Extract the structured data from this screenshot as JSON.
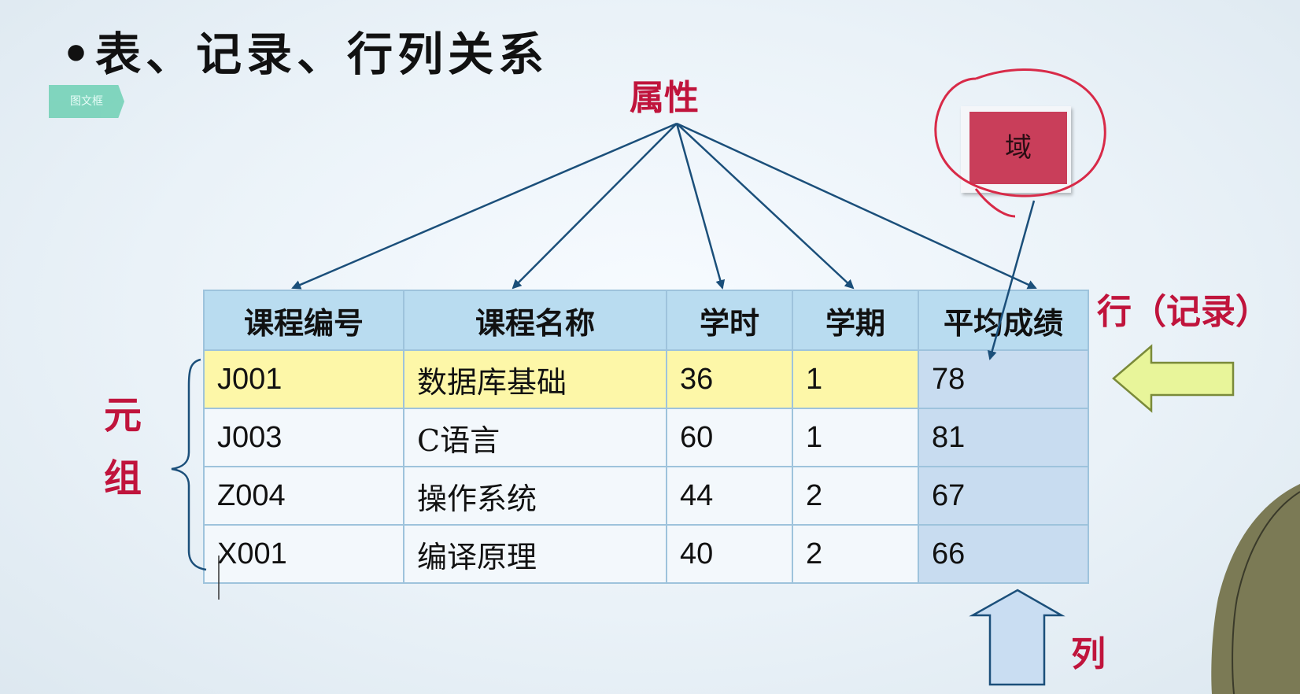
{
  "slide": {
    "title": "•表、记录、行列关系",
    "tag_label": "图文框"
  },
  "labels": {
    "attribute": "属性",
    "row_record": "行（记录）",
    "tuple": "元组",
    "column": "列",
    "domain": "域"
  },
  "table": {
    "headers": [
      "课程编号",
      "课程名称",
      "学时",
      "学期",
      "平均成绩"
    ],
    "rows": [
      [
        "J001",
        "数据库基础",
        "36",
        "1",
        "78"
      ],
      [
        "J003",
        "C语言",
        "60",
        "1",
        "81"
      ],
      [
        "Z004",
        "操作系统",
        "44",
        "2",
        "67"
      ],
      [
        "X001",
        "编译原理",
        "40",
        "2",
        "66"
      ]
    ],
    "highlighted_row_index": 0
  },
  "colors": {
    "accent_red": "#c0143c",
    "header_blue": "#b9dcf0",
    "highlight_yellow": "#fdf7a8",
    "domain_box": "#c93e5a",
    "arrow_blue": "#1b4f7a",
    "row_arrow_fill": "#e8f59a",
    "col_arrow_fill": "#c9ddf2"
  }
}
